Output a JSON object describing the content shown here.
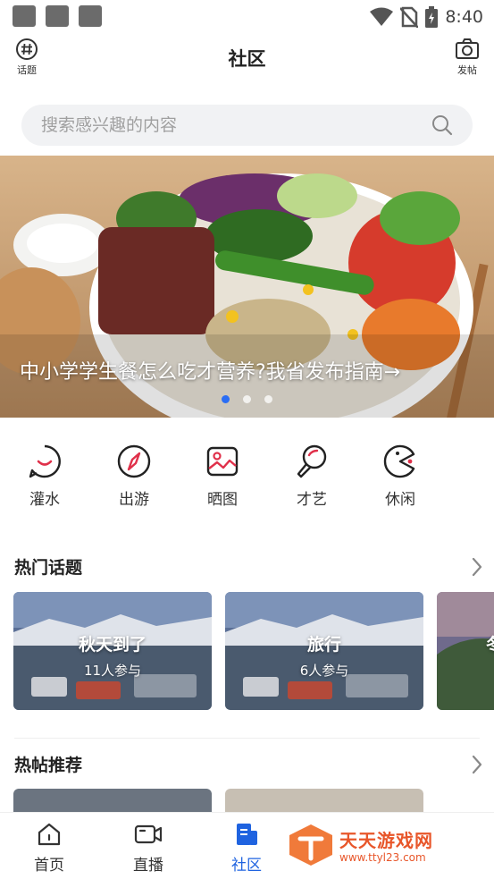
{
  "status_bar": {
    "time": "8:40"
  },
  "header": {
    "title": "社区",
    "left_button": {
      "label": "话题",
      "icon": "hashtag-icon"
    },
    "right_button": {
      "label": "发帖",
      "icon": "camera-icon"
    }
  },
  "search": {
    "placeholder": "搜索感兴趣的内容"
  },
  "banner": {
    "caption": "中小学学生餐怎么吃才营养?我省发布指南→",
    "dots_count": 3,
    "active_dot": 1
  },
  "categories": [
    {
      "label": "灌水",
      "icon": "smile-bubble-icon"
    },
    {
      "label": "出游",
      "icon": "compass-icon"
    },
    {
      "label": "晒图",
      "icon": "image-icon"
    },
    {
      "label": "才艺",
      "icon": "microphone-icon"
    },
    {
      "label": "休闲",
      "icon": "pacman-icon"
    }
  ],
  "hot_topics": {
    "title": "热门话题",
    "items": [
      {
        "title": "秋天到了",
        "participants": "11人参与"
      },
      {
        "title": "旅行",
        "participants": "6人参与"
      },
      {
        "title": "冬",
        "participants": ""
      }
    ]
  },
  "hot_posts": {
    "title": "热帖推荐"
  },
  "bottom_nav": [
    {
      "label": "首页",
      "icon": "home-icon"
    },
    {
      "label": "直播",
      "icon": "video-icon"
    },
    {
      "label": "社区",
      "icon": "community-icon",
      "active": true
    }
  ],
  "watermark": {
    "title": "天天游戏网",
    "url": "www.ttyl23.com"
  },
  "colors": {
    "accent": "#1f63e0",
    "category_accent": "#e0304a"
  }
}
